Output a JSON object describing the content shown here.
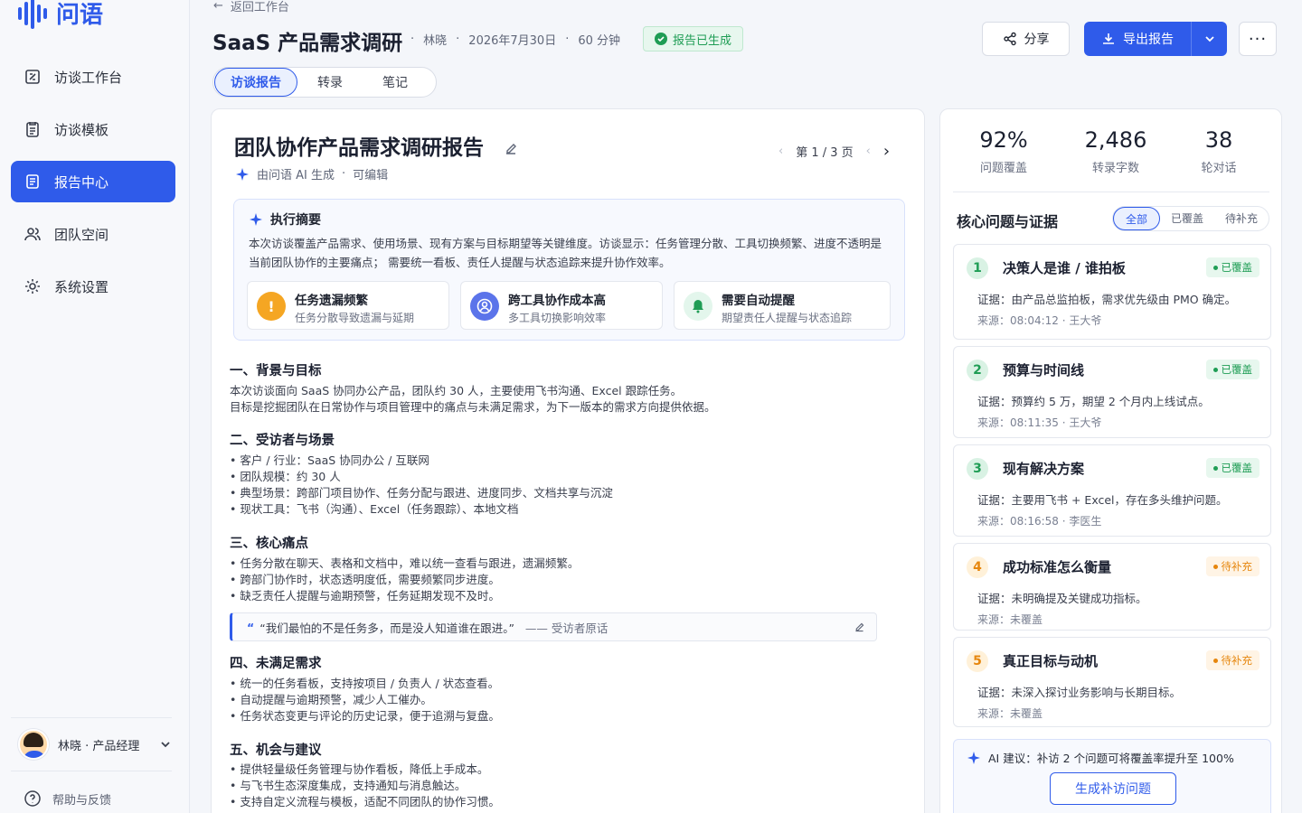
{
  "app": {
    "name": "问语"
  },
  "sidebar": {
    "items": [
      {
        "label": "访谈工作台",
        "icon": "workbench-icon"
      },
      {
        "label": "访谈模板",
        "icon": "template-icon"
      },
      {
        "label": "报告中心",
        "icon": "report-icon",
        "active": true
      },
      {
        "label": "团队空间",
        "icon": "team-icon"
      },
      {
        "label": "系统设置",
        "icon": "gear-icon"
      }
    ],
    "user": "林晓 · 产品经理",
    "help": "帮助与反馈"
  },
  "header": {
    "back": "返回工作台",
    "title": "SaaS 产品需求调研",
    "author": "林晓",
    "date": "2026年7月30日",
    "duration": "60 分钟",
    "status": "报告已生成",
    "share": "分享",
    "export": "导出报告",
    "more": "···"
  },
  "tabs": [
    "访谈报告",
    "转录",
    "笔记"
  ],
  "report": {
    "title": "团队协作产品需求调研报告",
    "generated_by": "由问语 AI 生成",
    "editable": "可编辑",
    "page": "第 1 / 3 页",
    "summary": {
      "heading": "执行摘要",
      "text": "本次访谈覆盖产品需求、使用场景、现有方案与目标期望等关键维度。访谈显示：任务管理分散、工具切换频繁、进度不透明是当前团队协作的主要痛点；    需要统一看板、责任人提醒与状态追踪来提升协作效率。",
      "cards": [
        {
          "title": "任务遗漏频繁",
          "desc": "任务分散导致遗漏与延期",
          "icon": "!"
        },
        {
          "title": "跨工具协作成本高",
          "desc": "多工具切换影响效率",
          "icon": "user-icon"
        },
        {
          "title": "需要自动提醒",
          "desc": "期望责任人提醒与状态追踪",
          "icon": "bell-icon"
        }
      ]
    },
    "sections": [
      {
        "title": "一、背景与目标",
        "lines": [
          "本次访谈面向 SaaS 协同办公产品，团队约 30 人，主要使用飞书沟通、Excel 跟踪任务。",
          "目标是挖掘团队在日常协作与项目管理中的痛点与未满足需求，为下一版本的需求方向提供依据。"
        ]
      },
      {
        "title": "二、受访者与场景",
        "lines": [
          "• 客户 / 行业：SaaS 协同办公 / 互联网",
          "• 团队规模：约 30 人",
          "• 典型场景：跨部门项目协作、任务分配与跟进、进度同步、文档共享与沉淀",
          "• 现状工具：飞书（沟通）、Excel（任务跟踪）、本地文档"
        ]
      },
      {
        "title": "三、核心痛点",
        "lines": [
          "• 任务分散在聊天、表格和文档中，难以统一查看与跟进，遗漏频繁。",
          "• 跨部门协作时，状态透明度低，需要频繁同步进度。",
          "• 缺乏责任人提醒与逾期预警，任务延期发现不及时。"
        ]
      },
      {
        "title": "四、未满足需求",
        "lines": [
          "• 统一的任务看板，支持按项目 / 负责人 / 状态查看。",
          "• 自动提醒与逾期预警，减少人工催办。",
          "• 任务状态变更与评论的历史记录，便于追溯与复盘。"
        ]
      },
      {
        "title": "五、机会与建议",
        "lines": [
          "• 提供轻量级任务管理与协作看板，降低上手成本。",
          "• 与飞书生态深度集成，支持通知与消息触达。",
          "• 支持自定义流程与模板，适配不同团队的协作习惯。"
        ]
      }
    ],
    "quote": {
      "text": "“我们最怕的不是任务多，而是没人知道谁在跟进。”",
      "source": "—— 受访者原话"
    }
  },
  "stats": [
    {
      "value": "92%",
      "label": "问题覆盖"
    },
    {
      "value": "2,486",
      "label": "转录字数"
    },
    {
      "value": "38",
      "label": "轮对话"
    }
  ],
  "questions": {
    "heading": "核心问题与证据",
    "filters": [
      "全部",
      "已覆盖",
      "待补充"
    ],
    "items": [
      {
        "num": "1",
        "title": "决策人是谁 / 谁拍板",
        "status": "已覆盖",
        "evidence": "证据：由产品总监拍板，需求优先级由 PMO 确定。",
        "source": "来源：08:04:12 · 王大爷"
      },
      {
        "num": "2",
        "title": "预算与时间线",
        "status": "已覆盖",
        "evidence": "证据：预算约 5 万，期望 2 个月内上线试点。",
        "source": "来源：08:11:35 · 王大爷"
      },
      {
        "num": "3",
        "title": "现有解决方案",
        "status": "已覆盖",
        "evidence": "证据：主要用飞书 + Excel，存在多头维护问题。",
        "source": "来源：08:16:58 · 李医生"
      },
      {
        "num": "4",
        "title": "成功标准怎么衡量",
        "status": "待补充",
        "evidence": "证据：未明确提及关键成功指标。",
        "source": "来源：未覆盖"
      },
      {
        "num": "5",
        "title": "真正目标与动机",
        "status": "待补充",
        "evidence": "证据：未深入探讨业务影响与长期目标。",
        "source": "来源：未覆盖"
      }
    ],
    "ai_tip": "AI 建议：补访 2 个问题可将覆盖率提升至 100%",
    "ai_button": "生成补访问题"
  },
  "colors": {
    "accent": "#2f5bea",
    "covered": "#1f9d55",
    "pending": "#e6860d"
  }
}
